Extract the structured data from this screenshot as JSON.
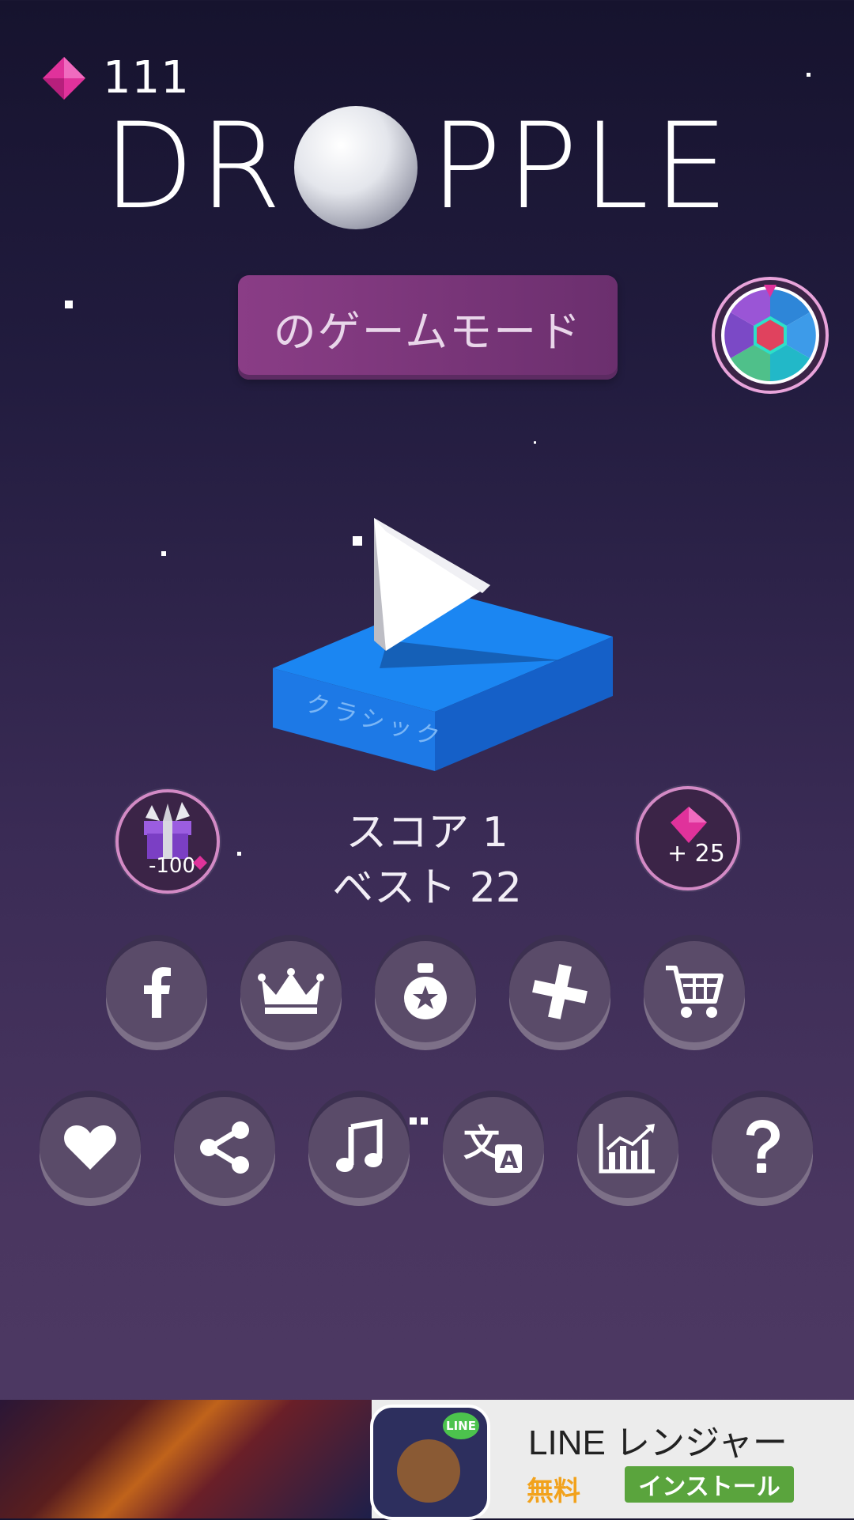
{
  "gems": {
    "count": "111"
  },
  "logo": {
    "text_left": "DR",
    "text_right": "PPLE"
  },
  "mode_button": {
    "label": "のゲームモード"
  },
  "play": {
    "platform_label": "クラシック"
  },
  "score": {
    "score_text": "スコア 1",
    "best_text": "ベスト 22"
  },
  "gift": {
    "cost": "-100"
  },
  "gem_bonus": {
    "amount": "+ 25"
  },
  "toolbar_row1": [
    "facebook-icon",
    "crown-icon",
    "medal-icon",
    "remove-ads-icon",
    "cart-icon"
  ],
  "toolbar_row2": [
    "heart-icon",
    "share-icon",
    "music-icon",
    "language-icon",
    "stats-icon",
    "help-icon"
  ],
  "ad": {
    "title": "LINE レンジャー",
    "price": "無料",
    "install_label": "インストール",
    "app_badge": "LINE"
  },
  "colors": {
    "gem": "#e0329b",
    "platform_top": "#1b86f2",
    "platform_side": "#1560c8",
    "mode_button": "#8a3d86",
    "install_green": "#5aa43d",
    "price_orange": "#f2a21c"
  }
}
